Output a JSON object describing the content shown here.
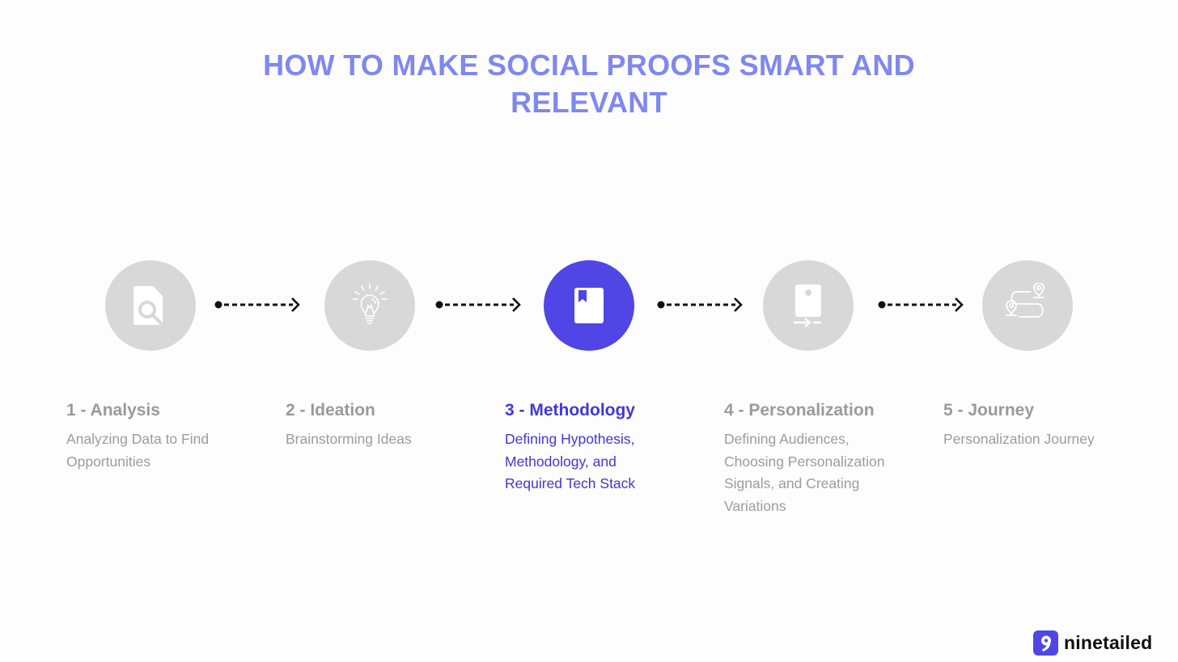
{
  "title": {
    "line1": "HOW TO MAKE SOCIAL PROOFS SMART AND",
    "line2": "RELEVANT"
  },
  "colors": {
    "title": "#7f88f0",
    "accent": "#4f46e5",
    "inactive_circle": "#d8d8d8",
    "inactive_text": "#9a9a9a",
    "arrow": "#111111"
  },
  "steps": [
    {
      "icon": "document-search-icon",
      "title": "1 - Analysis",
      "description": "Analyzing Data to Find Opportunities",
      "active": false
    },
    {
      "icon": "lightbulb-icon",
      "title": "2 - Ideation",
      "description": "Brainstorming Ideas",
      "active": false
    },
    {
      "icon": "bookmark-book-icon",
      "title": "3 - Methodology",
      "description": "Defining Hypothesis, Methodology, and Required Tech Stack",
      "active": true
    },
    {
      "icon": "device-transfer-icon",
      "title": "4 - Personalization",
      "description": "Defining Audiences, Choosing Personalization Signals, and Creating Variations",
      "active": false
    },
    {
      "icon": "route-map-icon",
      "title": "5 - Journey",
      "description": "Personalization Journey",
      "active": false
    }
  ],
  "arrows": [
    {
      "from": 1,
      "to": 2
    },
    {
      "from": 2,
      "to": 3
    },
    {
      "from": 3,
      "to": 4
    },
    {
      "from": 4,
      "to": 5
    }
  ],
  "logo": {
    "mark": "9",
    "text": "ninetailed"
  }
}
